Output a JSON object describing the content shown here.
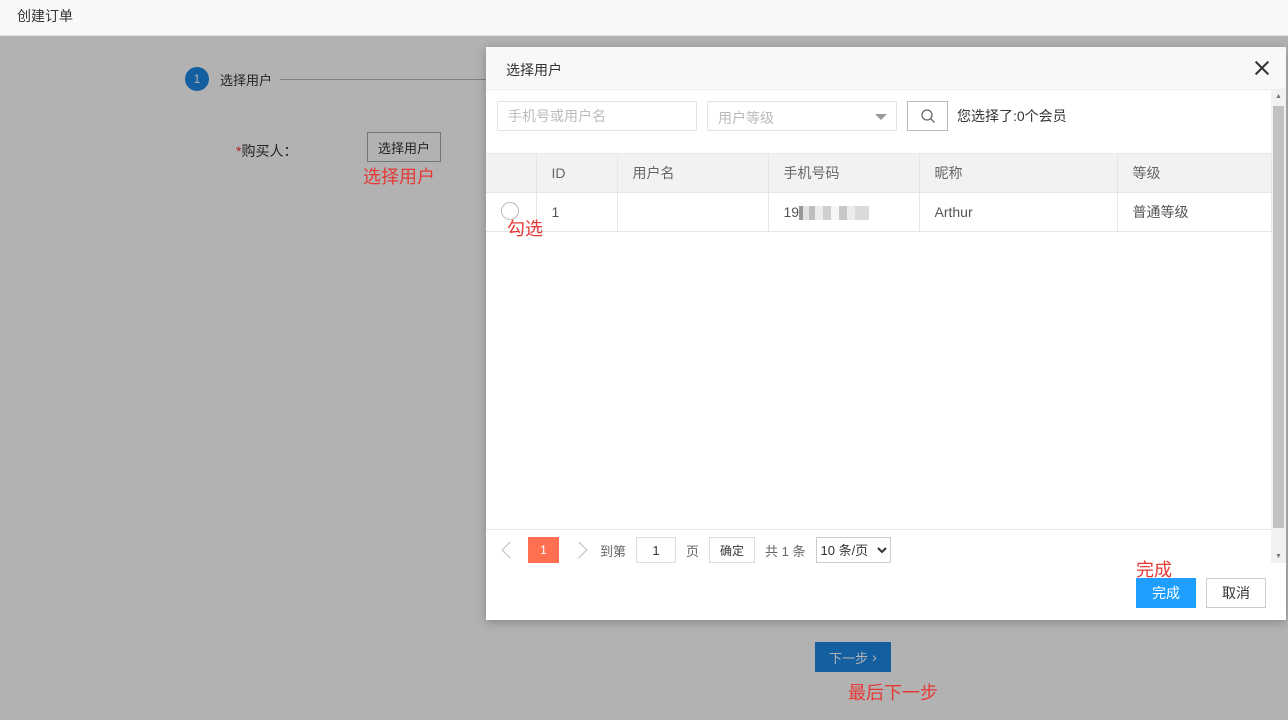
{
  "header": {
    "title": "创建订单"
  },
  "steps": [
    {
      "number": "1",
      "label": "选择用户"
    }
  ],
  "form": {
    "required_mark": "*",
    "buyer_label": "购买人：",
    "pick_user_button": "选择用户",
    "next_button": "下一步",
    "next_icon": "chevron-right-icon"
  },
  "annotations": {
    "pick_user": "选择用户",
    "check": "勾选",
    "finish": "完成",
    "last_next": "最后下一步"
  },
  "modal": {
    "title": "选择用户",
    "search": {
      "phone_placeholder": "手机号或用户名",
      "level_placeholder": "用户等级",
      "selected_info": "您选择了:0个会员"
    },
    "table": {
      "columns": [
        "ID",
        "用户名",
        "手机号码",
        "昵称",
        "等级"
      ],
      "rows": [
        {
          "id": "1",
          "username": "",
          "phone": "19",
          "nickname": "Arthur",
          "level": "普通等级"
        }
      ]
    },
    "pager": {
      "current_page": "1",
      "goto_label": "到第",
      "goto_value": "1",
      "page_unit": "页",
      "confirm_label": "确定",
      "total_label": "共 1 条",
      "page_size": "10 条/页"
    },
    "buttons": {
      "finish": "完成",
      "cancel": "取消"
    }
  },
  "colors": {
    "primary": "#1e9fff",
    "step_blue": "#1e88e5",
    "current_page": "#ff6f50",
    "annotation": "#e53935"
  }
}
